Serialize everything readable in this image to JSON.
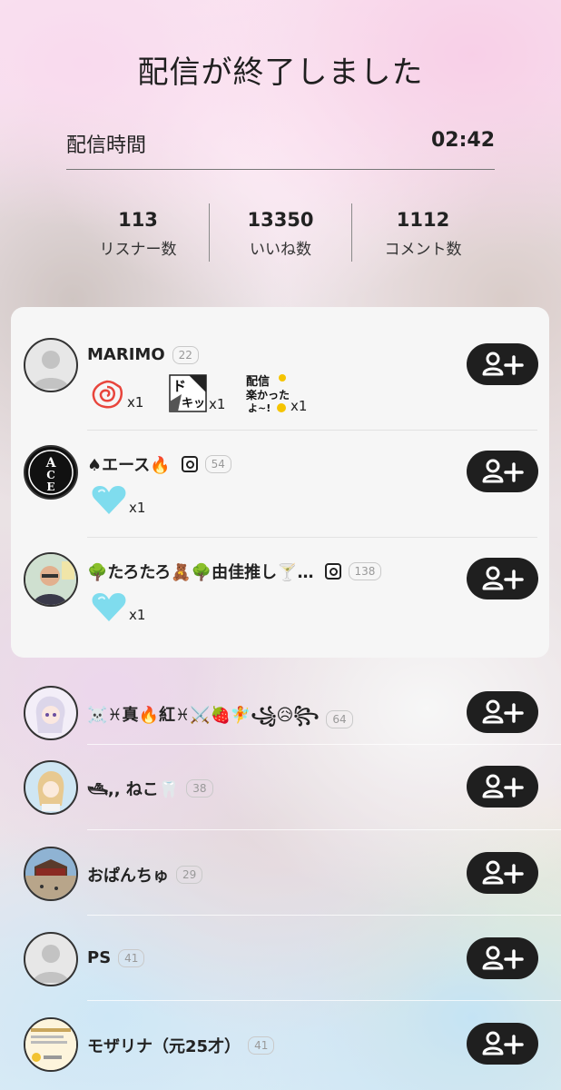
{
  "summary": {
    "title": "配信が終了しました",
    "duration_label": "配信時間",
    "duration_value": "02:42"
  },
  "stats": [
    {
      "value": "113",
      "label": "リスナー数"
    },
    {
      "value": "13350",
      "label": "いいね数"
    },
    {
      "value": "1112",
      "label": "コメント数"
    }
  ],
  "gifters": [
    {
      "name": "MARIMO",
      "level": "22",
      "instagram": false,
      "gifts": [
        {
          "icon": "spiral-flower-gift-icon",
          "count": "x1"
        },
        {
          "icon": "dokit-manga-gift-icon",
          "count": "x1"
        },
        {
          "icon": "haishin-tanoshikatta-gift-icon",
          "count": "x1"
        }
      ]
    },
    {
      "name": "♠エース🔥",
      "level": "54",
      "instagram": true,
      "gifts": [
        {
          "icon": "blue-heart-icon",
          "count": "x1"
        }
      ]
    },
    {
      "name": "🌳たろたろ🧸🌳由佳推し🍸…",
      "level": "138",
      "instagram": true,
      "gifts": [
        {
          "icon": "blue-heart-icon",
          "count": "x1"
        }
      ]
    }
  ],
  "listeners": [
    {
      "name": "☠️♓真🔥紅♓⚔️🍓🧚꧁😥꧂",
      "level": "64"
    },
    {
      "name": "🛥,, ねこ🦷",
      "level": "38"
    },
    {
      "name": "おぱんちゅ",
      "level": "29"
    },
    {
      "name": "PS",
      "level": "41"
    },
    {
      "name": "モザリナ（元25才）",
      "level": "41"
    }
  ],
  "colors": {
    "follow_button": "#1f1f1f",
    "heart_gift": "#7fdcee",
    "flower_gift": "#e8453c"
  }
}
